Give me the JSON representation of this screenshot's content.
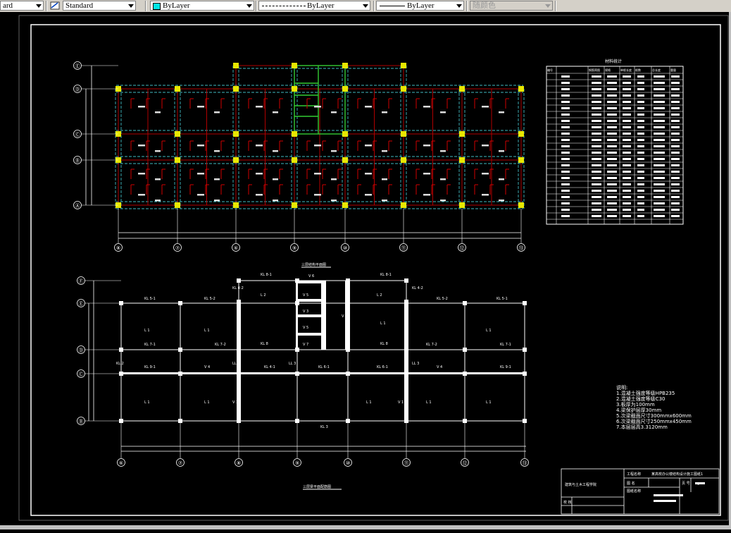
{
  "toolbar": {
    "text_style": "ard",
    "dim_style": "Standard",
    "layer_color": "ByLayer",
    "linetype": "ByLayer",
    "lineweight": "ByLayer",
    "plot_style": "随颜色",
    "colors": {
      "layer_swatch": "#00e5e5"
    }
  },
  "drawing": {
    "top_plan": {
      "axis_labels": [
        "⑧",
        "⑦",
        "⑥",
        "⑨",
        "⑩",
        "⑪",
        "⑫",
        "⑬"
      ],
      "row_labels": [
        "Ⓔ",
        "Ⓓ",
        "Ⓒ",
        "Ⓑ",
        "Ⓐ"
      ],
      "title": "三层结构平面图"
    },
    "bottom_plan": {
      "axis_labels": [
        "⑥",
        "⑦",
        "⑧",
        "⑨",
        "⑩",
        "⑪",
        "⑫",
        "⑬"
      ],
      "row_labels": [
        "Ⓕ",
        "Ⓔ",
        "Ⓓ",
        "Ⓒ",
        "Ⓑ"
      ],
      "title": "三层梁平面配筋图",
      "beam_labels": [
        "KL 8-1",
        "KL 8-1",
        "L 2",
        "L 2",
        "V 6",
        "KL 4-2",
        "KL 4-2",
        "KL 5-1",
        "KL 5-2",
        "KL 5-2",
        "KL 5-1",
        "L 1",
        "L 1",
        "V 5",
        "V 3",
        "V 2",
        "V 5",
        "L 1",
        "L 1",
        "KL 7-1",
        "KL 7-2",
        "KL 8",
        "V 7",
        "KL 8",
        "KL 7-2",
        "KL 7-1",
        "KL 2",
        "V 4",
        "LL 3",
        "KL 4-1",
        "KL 6-1",
        "LL 3",
        "KL 6-1",
        "V 4",
        "LL 3",
        "KL 9-1",
        "KL 9-1",
        "L 1",
        "L 1",
        "V 1",
        "L 1",
        "V 1",
        "L 1",
        "L 1",
        "KL 3"
      ]
    },
    "notes": {
      "heading": "说明:",
      "lines": [
        "1.混凝土强度等级HPB235",
        "2.混凝土强度等级C30",
        "3.板厚为100mm",
        "4.梁保护层厚30mm",
        "5.次梁截面尺寸300mmx600mm",
        "6.次梁截面尺寸250mmx450mm",
        "7.本层层高3.3120mm"
      ]
    },
    "title_block": {
      "school": "建筑与土木工程学院",
      "label1": "工程名称",
      "label2": "图 名",
      "label3": "图纸名称",
      "label4": "校 核",
      "project": "某高校办公楼结构设计施工图纸1",
      "page_label": "页 号",
      "page_value": "9"
    },
    "table": {
      "title": "材料统计",
      "headers": [
        "编号",
        "钢筋简图",
        "规格",
        "单根长度",
        "根数",
        "总长度",
        "重量"
      ]
    }
  }
}
